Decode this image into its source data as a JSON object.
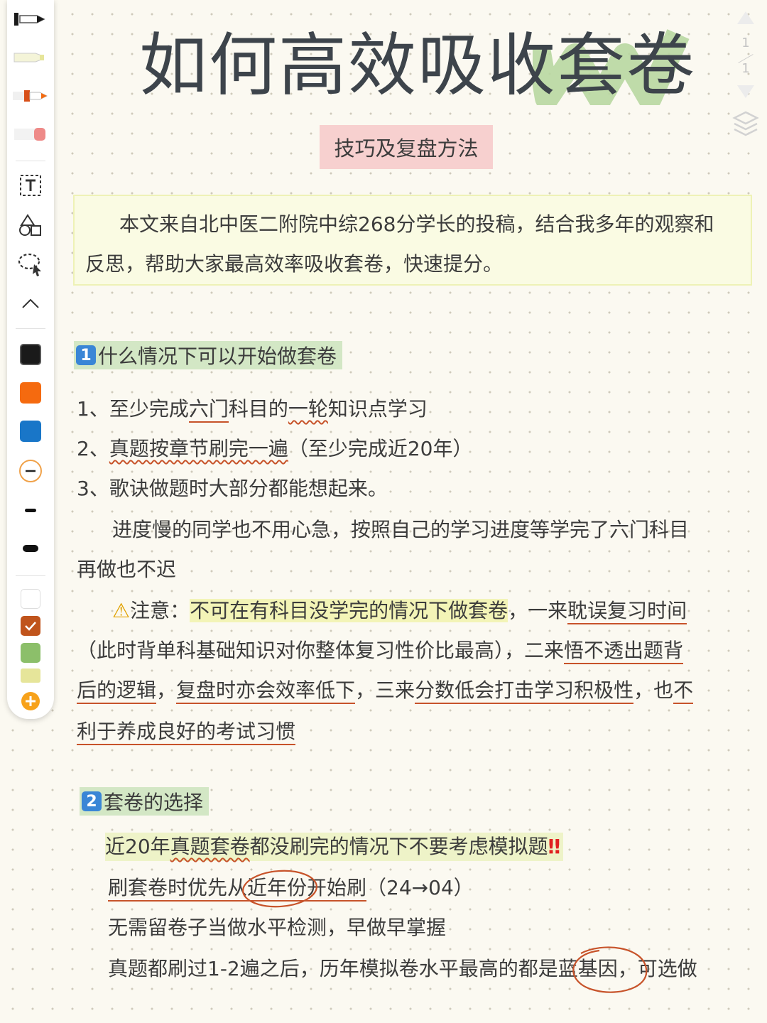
{
  "toolbar": {
    "tools": [
      "pen-icon",
      "highlighter-icon",
      "marker-icon",
      "eraser-icon",
      "text-tool-icon",
      "shapes-icon",
      "lasso-icon",
      "collapse-icon"
    ],
    "colors": [
      "#1a1a1a",
      "#f56a0f",
      "#1976c8"
    ],
    "highlight_colors": [
      "#ffffff",
      "#c0541c",
      "#8cbf6a",
      "#e6e59a"
    ]
  },
  "pager": {
    "current": "1",
    "total": "1"
  },
  "title": "如何高效吸收套卷",
  "subtitle": "技巧及复盘方法",
  "intro": {
    "line1": "本文来自北中医二附院中综268分学长的投稿，结合我多年的观察和",
    "line2": "反思，帮助大家最高效率吸收套卷，快速提分。"
  },
  "section1": {
    "num": "1",
    "title": "什么情况下可以开始做套卷",
    "item1": {
      "a": "1、至少完成",
      "b": "六门",
      "c": "科目的",
      "d": "一轮",
      "e": "知识点学习"
    },
    "item2": {
      "a": "2、",
      "b": "真题按章节刷完一遍",
      "c": "（至少完成近20年）"
    },
    "item3": "3、歌诀做题时大部分都能想起来。",
    "para1": "进度慢的同学也不用心急，按照自己的学习进度等学完了六门科目",
    "para2": "再做也不迟",
    "note": {
      "icon": "⚠",
      "label": "注意：",
      "hl": "不可在有科目没学完的情况下做套卷",
      "c1": "，一来",
      "u1": "耽误复习时间",
      "l2a": "（此时背单科基础知识对你整体复习性价比最高），二来",
      "u2": "悟不透出题背",
      "u3": "后的逻辑",
      "c3": "，",
      "u4": "复盘时亦会效率低下",
      "c4": "，三来",
      "u5": "分数低会打击学习积极性",
      "c5": "，也",
      "u6": "不",
      "u7": "利于养成良好的考试习惯"
    }
  },
  "section2": {
    "num": "2",
    "title": "套卷的选择",
    "l1": {
      "a": "近20年",
      "b": "真题套卷",
      "c": "都没刷完的情况下不要考虑模拟题",
      "bang": "‼"
    },
    "l2": {
      "a": "刷套卷时优先从",
      "b": "近年份",
      "c": "开始刷",
      "d": "（24→04）"
    },
    "l3": "无需留卷子当做水平检测，早做早掌握",
    "l4": {
      "a": "真题都刷过1-2遍之后，历年模拟卷水平最高的都是",
      "b": "蓝基因",
      "c": "，可选做"
    }
  }
}
